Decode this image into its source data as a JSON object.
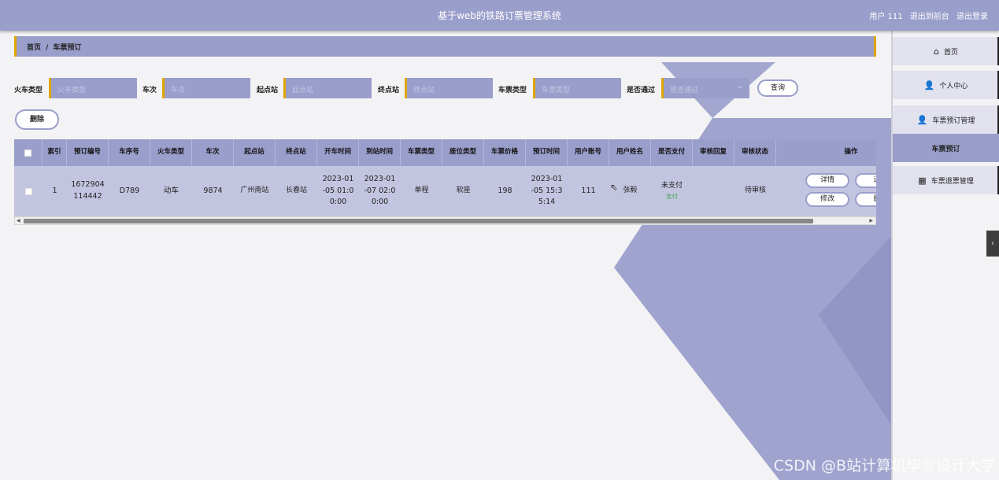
{
  "header": {
    "title": "基于web的铁路订票管理系统",
    "user_label": "用户 111",
    "back_label": "退出到前台",
    "logout_label": "退出登录"
  },
  "breadcrumb": {
    "home": "首页",
    "separator": "/",
    "current": "车票预订"
  },
  "search": {
    "train_type_label": "火车类型",
    "train_type_placeholder": "火车类型",
    "train_no_label": "车次",
    "train_no_placeholder": "车次",
    "start_label": "起点站",
    "start_placeholder": "起点站",
    "end_label": "终点站",
    "end_placeholder": "终点站",
    "ticket_type_label": "车票类型",
    "ticket_type_placeholder": "车票类型",
    "approved_label": "是否通过",
    "approved_placeholder": "是否通过",
    "query_label": "查询"
  },
  "actions": {
    "delete_label": "删除"
  },
  "table": {
    "headers": [
      "索引",
      "预订编号",
      "车序号",
      "火车类型",
      "车次",
      "起点站",
      "终点站",
      "开车时间",
      "到站时间",
      "车票类型",
      "座位类型",
      "车票价格",
      "预订时间",
      "用户账号",
      "用户姓名",
      "是否支付",
      "审核回复",
      "审核状态",
      "操作"
    ],
    "rows": [
      {
        "index": "1",
        "booking_no": "1672904\n114442",
        "car_no": "D789",
        "train_type": "动车",
        "train_no": "9874",
        "start": "广州南站",
        "end": "长春站",
        "depart": "2023-01\n-05 01:0\n0:00",
        "arrive": "2023-01\n-07 02:0\n0:00",
        "ticket_type": "单程",
        "seat_type": "软座",
        "price": "198",
        "booking_time": "2023-01\n-05 15:3\n5:14",
        "account": "111",
        "name": "张毅",
        "paid": "未支付",
        "pay_link": "支付",
        "review_reply": "",
        "review_status": "待审核",
        "ops": {
          "detail": "详情",
          "refund": "退",
          "edit": "修改",
          "delete": "删"
        }
      }
    ]
  },
  "sidebar": {
    "items": [
      {
        "label": "首页",
        "icon": "home-icon"
      },
      {
        "label": "个人中心",
        "icon": "user-icon"
      },
      {
        "label": "车票预订管理",
        "icon": "user-icon"
      },
      {
        "label": "车票预订",
        "icon": ""
      },
      {
        "label": "车票退票管理",
        "icon": "grid-icon"
      }
    ]
  },
  "watermark": "CSDN @B站计算机毕业设计大学",
  "colors": {
    "primary": "#9a9ecb",
    "accent": "#e0a500",
    "row_bg": "#c3c5e0",
    "pay_link": "#3da84a"
  }
}
